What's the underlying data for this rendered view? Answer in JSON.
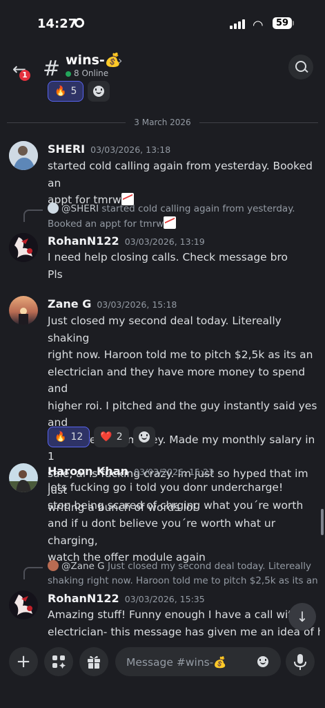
{
  "status_bar": {
    "time": "14:27",
    "battery": "59"
  },
  "header": {
    "back_badge": "1",
    "channel_symbol": "#",
    "channel_name": "wins-💰",
    "online": "8 Online"
  },
  "top_reactions": [
    {
      "emoji": "🔥",
      "count": "5"
    }
  ],
  "date_divider": "3 March 2026",
  "messages": [
    {
      "author": "SHERI",
      "timestamp": "03/03/2026, 13:18",
      "lines": [
        "started cold calling again from yesterday. Booked an",
        "appt for tmrw"
      ]
    },
    {
      "reply_author": "@SHERI",
      "reply_lines": [
        "started cold calling again from yesterday.",
        "Booked an appt for tmrw"
      ],
      "author": "RohanN122",
      "timestamp": "03/03/2026, 13:19",
      "lines": [
        "I need help closing calls. Check message bro"
      ],
      "followup": "Pls"
    },
    {
      "author": "Zane G",
      "timestamp": "03/03/2026, 15:18",
      "lines": [
        "Just closed my second deal today. Litereally shaking",
        "right now. Haroon told me to pitch $2,5k as its an",
        "electrician and they have more money to spend and",
        "higher roi. I pitched and the guy instantly said yes and",
        "transfered the money. Made my monthly salary in 1",
        "sale, ai is fucking crazy. Im just so hyped that im just",
        "writing a bunch of words lol"
      ],
      "reactions": [
        {
          "emoji": "🔥",
          "count": "12"
        },
        {
          "emoji": "❤️",
          "count": "2"
        }
      ]
    },
    {
      "author": "Haroon Khan",
      "timestamp": "03/03/2026, 15:23",
      "lines": [
        "lets fucking go i told you donr undercharge!"
      ],
      "followups": [
        "stop being scared of chrging what you´re worth",
        "and if u dont believe you´re worth what ur charging,",
        "watch the offer module again"
      ]
    },
    {
      "reply_author": "@Zane G",
      "reply_lines": [
        "Just closed my second deal today. Litereally",
        "shaking right now. Haroon told me to pitch $2,5k as its an ..."
      ],
      "author": "RohanN122",
      "timestamp": "03/03/2026, 15:35",
      "lines": [
        "Amazing stuff! Funny enough I have a  call with a",
        "electrician- this message has given me an idea of how"
      ]
    }
  ],
  "composer": {
    "placeholder": "Message #wins-💰"
  },
  "colors": {
    "accent": "#5865f2",
    "online": "#23a55a",
    "badge": "#e5313d",
    "background": "#1c1d22"
  }
}
